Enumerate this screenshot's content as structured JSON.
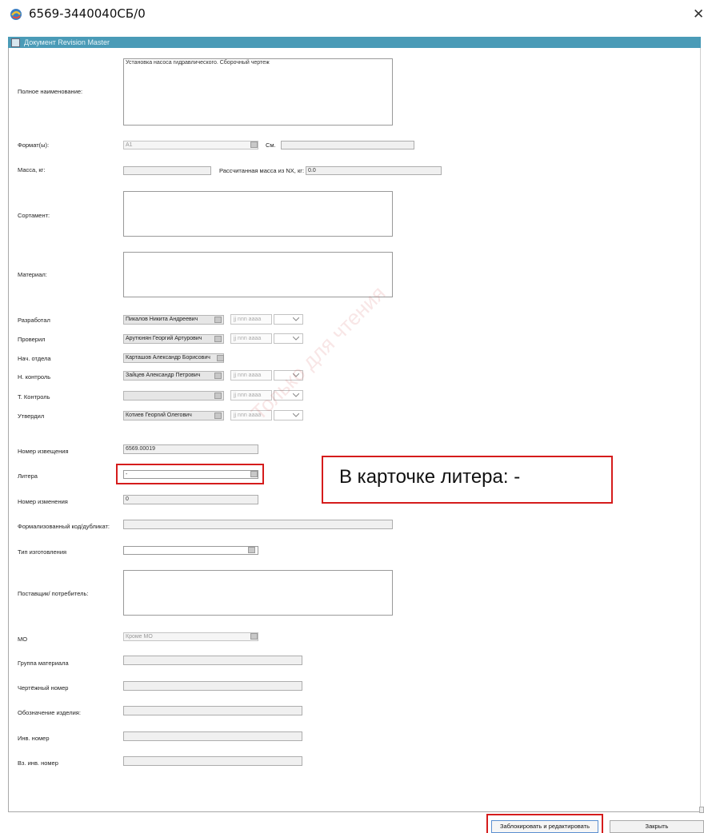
{
  "window": {
    "title": "6569-3440040СБ/0",
    "app_icon": "app-swirl-icon",
    "close_glyph": "✕"
  },
  "docbar": {
    "label": "Документ Revision Master"
  },
  "form": {
    "full_name": {
      "label": "Полное наименование:",
      "value": "Установка насоса гидравлического. Сборочный чертеж"
    },
    "format": {
      "label": "Формат(ы):",
      "value": "А1",
      "see_label": "См.",
      "see_value": ""
    },
    "mass": {
      "label": "Масса, кг:",
      "value": "",
      "calc_label": "Рассчитанная масса из NX, кг:",
      "calc_value": "0.0"
    },
    "sortament": {
      "label": "Сортамент:",
      "value": ""
    },
    "material": {
      "label": "Материал:",
      "value": ""
    },
    "signatures": [
      {
        "label": "Разработал",
        "name": "Пикалов Никита Андреевич",
        "date": "jj nnn aaaa"
      },
      {
        "label": "Проверил",
        "name": "Арутюнян Георгий Артурович",
        "date": "jj nnn aaaa"
      },
      {
        "label": "Нач. отдела",
        "name": "Карташов Александр Борисович",
        "date": ""
      },
      {
        "label": "Н. контроль",
        "name": "Зайцев Александр Петрович",
        "date": "jj nnn aaaa"
      },
      {
        "label": "Т. Контроль",
        "name": "",
        "date": "jj nnn aaaa"
      },
      {
        "label": "Утвердил",
        "name": "Котиев Георгий Олегович",
        "date": "jj nnn aaaa"
      }
    ],
    "notice_number": {
      "label": "Номер извещения",
      "value": "6569.00019"
    },
    "litera": {
      "label": "Литера",
      "value": "-"
    },
    "change_number": {
      "label": "Номер изменения",
      "value": "0"
    },
    "formal_code": {
      "label": "Формализованный код/дубликат:",
      "value": ""
    },
    "manufacture_type": {
      "label": "Тип изготовления",
      "value": ""
    },
    "supplier": {
      "label": "Поставщик/ потребитель:",
      "value": ""
    },
    "mo": {
      "label": "МО",
      "value": "Кроме МО"
    },
    "material_group": {
      "label": "Группа материала",
      "value": ""
    },
    "drawing_number": {
      "label": "Чертёжный номер",
      "value": ""
    },
    "product_designation": {
      "label": "Обозначение изделия:",
      "value": ""
    },
    "inv_number": {
      "label": "Инв. номер",
      "value": ""
    },
    "vz_inv_number": {
      "label": "Вз. инв. номер",
      "value": ""
    }
  },
  "annotation": {
    "callout": "В карточке литера:   -",
    "watermark": "Только для чтения",
    "highlight_color": "#d51c1c"
  },
  "buttons": {
    "lock_edit": "Заблокировать и редактировать",
    "close": "Закрыть"
  }
}
